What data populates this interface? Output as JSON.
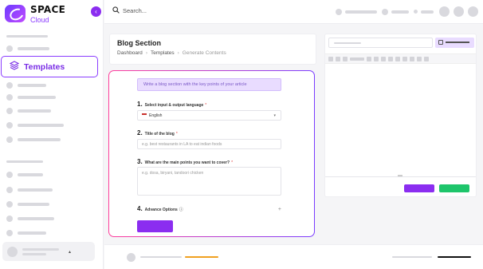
{
  "brand": {
    "name": "SPACE",
    "sub": "Cloud"
  },
  "sidebar": {
    "active_item": {
      "label": "Templates",
      "icon": "layers-icon"
    }
  },
  "topbar": {
    "search_placeholder": "Search..."
  },
  "page": {
    "title": "Blog Section",
    "breadcrumbs": [
      "Dashboard",
      "Templates",
      "Generate Contents"
    ]
  },
  "form": {
    "hint": "Write a blog section with the key points of your article",
    "q1": {
      "num": "1.",
      "label": "Select input & output language",
      "value": "English"
    },
    "q2": {
      "num": "2.",
      "label": "Title of the blog",
      "placeholder": "e.g. best restaurants in LA to eat indian foods"
    },
    "q3": {
      "num": "3.",
      "label": "What are the main points you want to cover?",
      "placeholder": "e.g. dosa, biryani, tandoori chicken"
    },
    "q4": {
      "num": "4.",
      "label": "Advance Options",
      "toggle": "+"
    }
  },
  "colors": {
    "accent": "#8b2df0",
    "success": "#1ec56b",
    "border_from": "#ff3e9b",
    "border_to": "#7a3cff"
  }
}
